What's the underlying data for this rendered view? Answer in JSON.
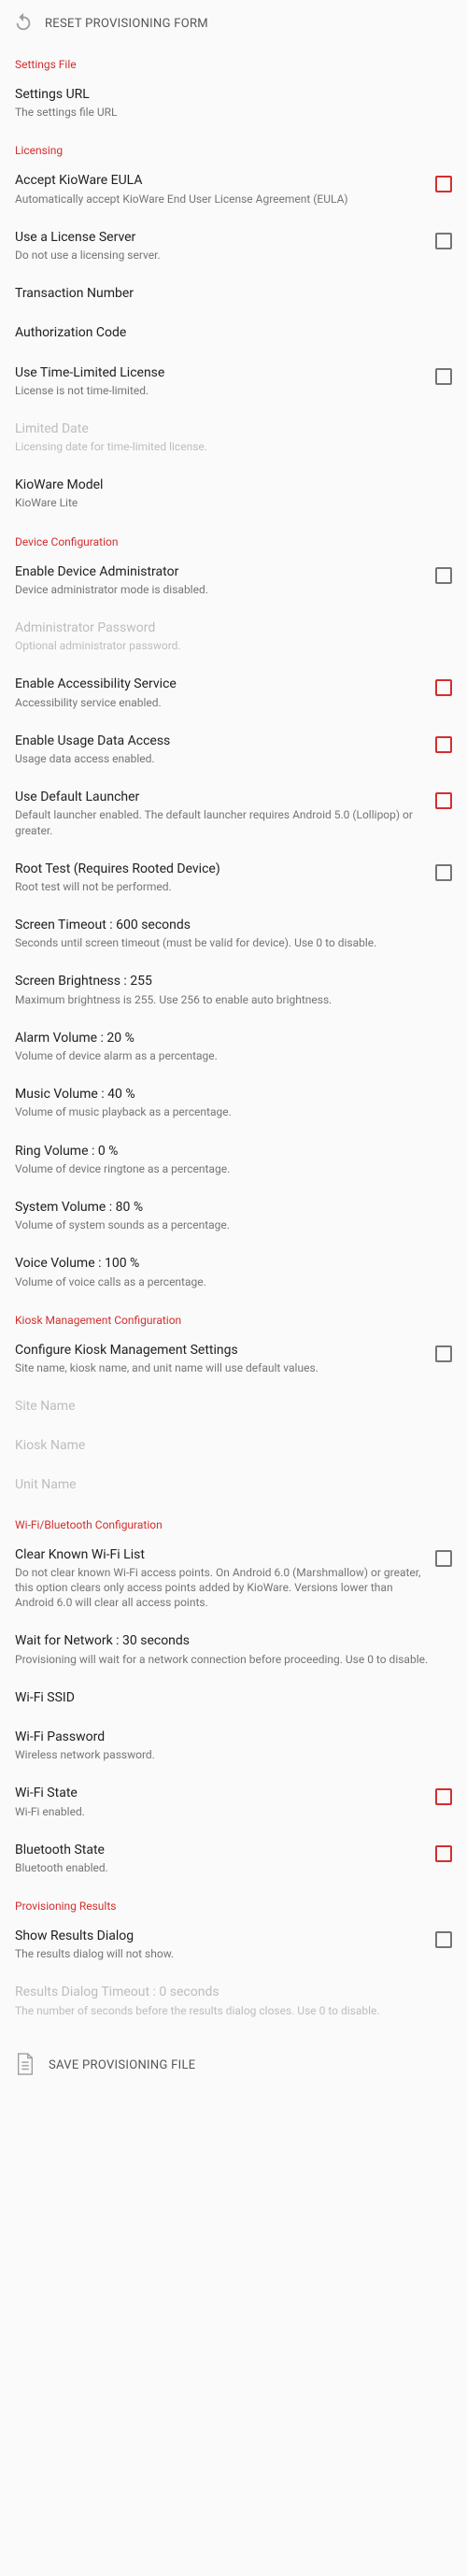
{
  "topbar": {
    "title": "RESET PROVISIONING FORM"
  },
  "sections": {
    "settings_file": {
      "header": "Settings File",
      "settings_url": {
        "title": "Settings URL",
        "sub": "The settings file URL"
      }
    },
    "licensing": {
      "header": "Licensing",
      "eula": {
        "title": "Accept KioWare EULA",
        "sub": "Automatically accept KioWare End User License Agreement (EULA)"
      },
      "license_server": {
        "title": "Use a License Server",
        "sub": "Do not use a licensing server."
      },
      "transaction": {
        "title": "Transaction Number"
      },
      "auth_code": {
        "title": "Authorization Code"
      },
      "time_limited": {
        "title": "Use Time-Limited License",
        "sub": "License is not time-limited."
      },
      "limited_date": {
        "title": "Limited Date",
        "sub": "Licensing date for time-limited license."
      },
      "model": {
        "title": "KioWare Model",
        "sub": "KioWare Lite"
      }
    },
    "device": {
      "header": "Device Configuration",
      "admin": {
        "title": "Enable Device Administrator",
        "sub": "Device administrator mode is disabled."
      },
      "admin_pw": {
        "title": "Administrator Password",
        "sub": "Optional administrator password."
      },
      "accessibility": {
        "title": "Enable Accessibility Service",
        "sub": "Accessibility service enabled."
      },
      "usage": {
        "title": "Enable Usage Data Access",
        "sub": "Usage data access enabled."
      },
      "launcher": {
        "title": "Use Default Launcher",
        "sub": "Default launcher enabled. The default launcher requires Android 5.0 (Lollipop) or greater."
      },
      "root": {
        "title": "Root Test (Requires Rooted Device)",
        "sub": "Root test will not be performed."
      },
      "screen_timeout": {
        "title": "Screen Timeout : 600 seconds",
        "sub": "Seconds until screen timeout (must be valid for device). Use 0 to disable."
      },
      "brightness": {
        "title": "Screen Brightness : 255",
        "sub": "Maximum brightness is 255. Use 256 to enable auto brightness."
      },
      "alarm": {
        "title": "Alarm Volume : 20 %",
        "sub": "Volume of device alarm as a percentage."
      },
      "music": {
        "title": "Music Volume : 40 %",
        "sub": "Volume of music playback as a percentage."
      },
      "ring": {
        "title": "Ring Volume : 0 %",
        "sub": "Volume of device ringtone as a percentage."
      },
      "system": {
        "title": "System Volume : 80 %",
        "sub": "Volume of system sounds as a percentage."
      },
      "voice": {
        "title": "Voice Volume : 100 %",
        "sub": "Volume of voice calls as a percentage."
      }
    },
    "kiosk": {
      "header": "Kiosk Management Configuration",
      "configure": {
        "title": "Configure Kiosk Management Settings",
        "sub": "Site name, kiosk name, and unit name will use default values."
      },
      "site": {
        "title": "Site Name"
      },
      "kiosk_name": {
        "title": "Kiosk Name"
      },
      "unit": {
        "title": "Unit Name"
      }
    },
    "wifi": {
      "header": "Wi-Fi/Bluetooth Configuration",
      "clear": {
        "title": "Clear Known Wi-Fi List",
        "sub": "Do not clear known Wi-Fi access points. On Android 6.0 (Marshmallow) or greater, this option clears only access points added by KioWare. Versions lower than Android 6.0 will clear all access points."
      },
      "wait": {
        "title": "Wait for Network : 30 seconds",
        "sub": "Provisioning will wait for a network connection before proceeding. Use 0 to disable."
      },
      "ssid": {
        "title": "Wi-Fi SSID"
      },
      "pw": {
        "title": "Wi-Fi Password",
        "sub": "Wireless network password."
      },
      "state": {
        "title": "Wi-Fi State",
        "sub": "Wi-Fi enabled."
      },
      "bt": {
        "title": "Bluetooth State",
        "sub": "Bluetooth enabled."
      }
    },
    "results": {
      "header": "Provisioning Results",
      "show": {
        "title": "Show Results Dialog",
        "sub": "The results dialog will not show."
      },
      "timeout": {
        "title": "Results Dialog Timeout : 0 seconds",
        "sub": "The number of seconds before the results dialog closes. Use 0 to disable."
      }
    }
  },
  "footer": {
    "label": "SAVE PROVISIONING FILE"
  }
}
